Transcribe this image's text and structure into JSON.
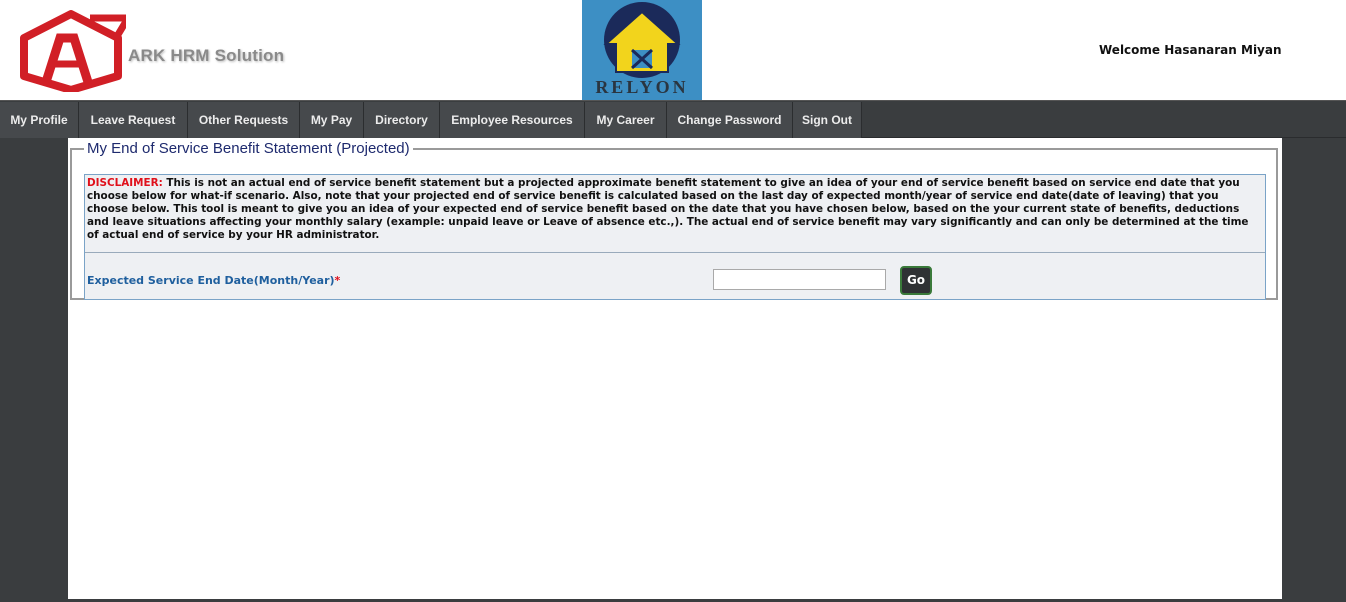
{
  "header": {
    "logo_text": "ARK HRM Solution",
    "partner_text": "RELYON",
    "welcome": "Welcome Hasanaran Miyan"
  },
  "nav": {
    "items": [
      "My Profile",
      "Leave Request",
      "Other Requests",
      "My Pay",
      "Directory",
      "Employee Resources",
      "My Career",
      "Change Password",
      "Sign Out"
    ]
  },
  "form": {
    "legend": "My End of Service Benefit Statement (Projected)",
    "disclaimer_label": "DISCLAIMER:",
    "disclaimer_text": "This is not an actual end of service benefit statement but a projected approximate benefit statement to give an idea of your end of service benefit based on service end date that you choose below for what-if scenario. Also, note that your projected end of service benefit is calculated based on the last day of expected month/year of service end date(date of leaving) that you choose below. This tool is meant to give you an idea of your expected end of service benefit based on the date that you have chosen below, based on the your current state of benefits, deductions and leave situations affecting your monthly salary (example: unpaid leave or Leave of absence etc.,). The actual end of service benefit may vary significantly and can only be determined at the time of actual end of service by your HR administrator.",
    "field_label": "Expected Service End Date(Month/Year)",
    "required_mark": "*",
    "date_value": "",
    "go_label": "Go"
  },
  "colors": {
    "nav_bg": "#3a3d3f",
    "accent_red": "#e0101b",
    "label_blue": "#1f5f9e",
    "legend_navy": "#1e2a6e"
  }
}
